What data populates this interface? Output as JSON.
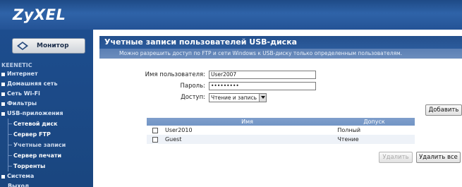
{
  "header": {
    "logo": "ZyXEL"
  },
  "sidebar": {
    "monitor_label": "Монитор",
    "section_label": "KEENETIC",
    "items": [
      {
        "label": "Интернет"
      },
      {
        "label": "Домашняя сеть"
      },
      {
        "label": "Сеть Wi-Fi"
      },
      {
        "label": "Фильтры"
      },
      {
        "label": "USB-приложения"
      }
    ],
    "subitems": [
      {
        "label": "Сетевой диск"
      },
      {
        "label": "Сервер FTP"
      },
      {
        "label": "Учетные записи"
      },
      {
        "label": "Сервер печати"
      },
      {
        "label": "Торренты"
      }
    ],
    "system_label": "Система",
    "logout_label": "Выход"
  },
  "main": {
    "title": "Учетные записи пользователей USB-диска",
    "description": "Можно разрешить доступ по FTP и сети Windows к USB-диску только определенным пользователям.",
    "form": {
      "username_label": "Имя пользователя:",
      "username_value": "User2007",
      "password_label": "Пароль:",
      "password_value": "•••••••••",
      "access_label": "Доступ:",
      "access_value": "Чтение и запись"
    },
    "add_button": "Добавить",
    "table": {
      "columns": [
        "Имя",
        "Допуск"
      ],
      "rows": [
        {
          "name": "User2010",
          "access": "Полный"
        },
        {
          "name": "Guest",
          "access": "Чтение"
        }
      ]
    },
    "delete_button": "Удалить",
    "delete_all_button": "Удалить все"
  }
}
